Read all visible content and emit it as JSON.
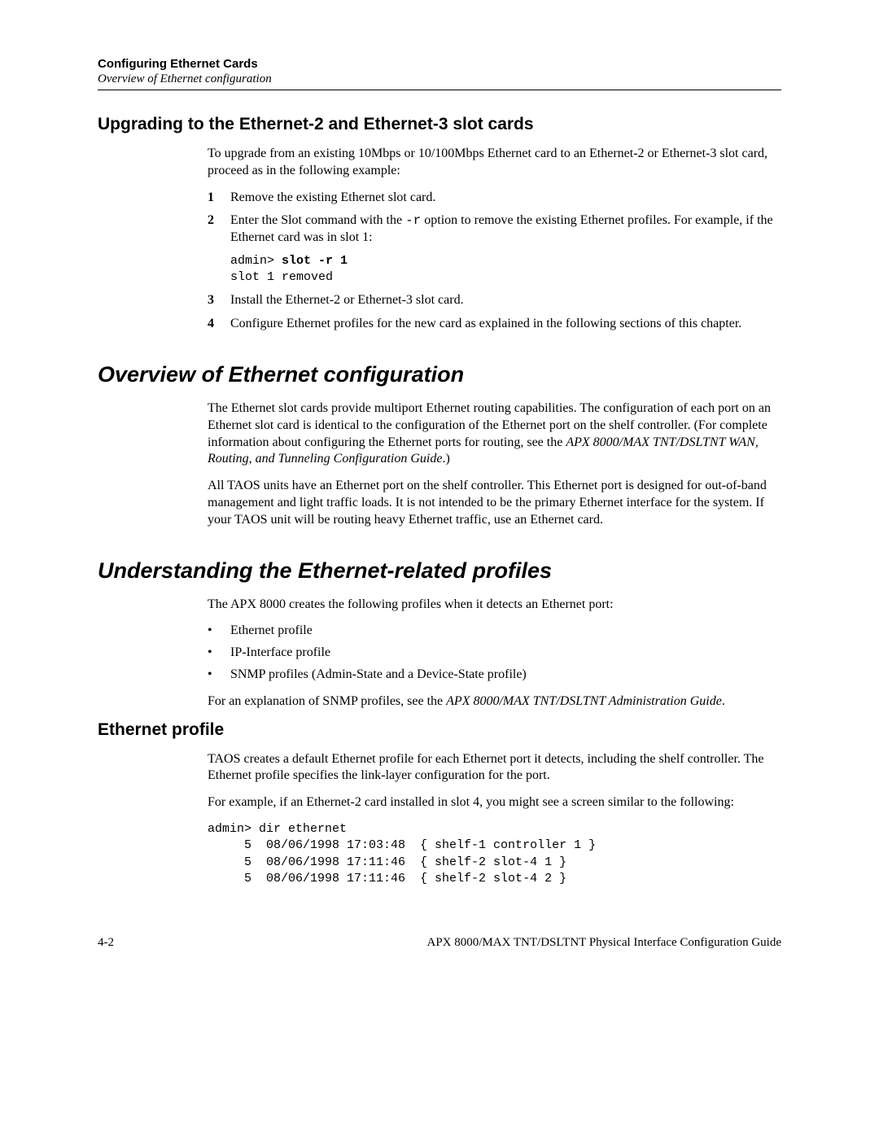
{
  "header": {
    "bold": "Configuring Ethernet Cards",
    "italic": "Overview of Ethernet configuration"
  },
  "section1": {
    "title": "Upgrading to the Ethernet-2 and Ethernet-3 slot cards",
    "intro": "To upgrade from an existing 10Mbps or 10/100Mbps Ethernet card to an Ethernet-2 or Ethernet-3 slot card, proceed as in the following example:",
    "step1_num": "1",
    "step1_txt": "Remove the existing Ethernet slot card.",
    "step2_num": "2",
    "step2_txt_a": "Enter the Slot command with the ",
    "step2_txt_opt": "-r",
    "step2_txt_b": " option to remove the existing Ethernet profiles. For example, if the Ethernet card was in slot 1:",
    "cmd_prompt": "admin> ",
    "cmd_bold": "slot -r 1",
    "cmd_output": "slot 1 removed",
    "step3_num": "3",
    "step3_txt": "Install the Ethernet-2 or Ethernet-3 slot card.",
    "step4_num": "4",
    "step4_txt": "Configure Ethernet profiles for the new card as explained in the following sections of this chapter."
  },
  "section2": {
    "title": "Overview of Ethernet configuration",
    "p1_a": "The Ethernet slot cards provide multiport Ethernet routing capabilities. The configuration of each port on an Ethernet slot card is identical to the configuration of the Ethernet port on the shelf controller. (For complete information about configuring the Ethernet ports for routing, see the ",
    "p1_ital": "APX 8000/MAX TNT/DSLTNT WAN, Routing, and Tunneling Configuration Guide",
    "p1_b": ".)",
    "p2": "All TAOS units have an Ethernet port on the shelf controller. This Ethernet port is designed for out-of-band management and light traffic loads. It is not intended to be the primary Ethernet interface for the system. If your TAOS unit will be routing heavy Ethernet traffic, use an Ethernet card."
  },
  "section3": {
    "title": "Understanding the Ethernet-related profiles",
    "intro": "The APX 8000 creates the following profiles when it detects an Ethernet port:",
    "bullet1": "Ethernet profile",
    "bullet2": "IP-Interface profile",
    "bullet3": "SNMP profiles (Admin-State and a Device-State profile)",
    "p2_a": "For an explanation of SNMP profiles, see the ",
    "p2_ital": "APX 8000/MAX TNT/DSLTNT Administration Guide",
    "p2_b": "."
  },
  "section4": {
    "title": "Ethernet profile",
    "p1": "TAOS creates a default Ethernet profile for each Ethernet port it detects, including the shelf controller. The Ethernet profile specifies the link-layer configuration for the port.",
    "p2": "For example, if an Ethernet-2 card installed in slot 4, you might see a screen similar to the following:",
    "cmd_prompt": "admin> ",
    "cmd_bold": "dir ethernet",
    "cmd_line1": "     5  08/06/1998 17:03:48  { shelf-1 controller 1 }",
    "cmd_line2": "     5  08/06/1998 17:11:46  { shelf-2 slot-4 1 }",
    "cmd_line3": "     5  08/06/1998 17:11:46  { shelf-2 slot-4 2 }"
  },
  "footer": {
    "left": "4-2",
    "right": "APX 8000/MAX TNT/DSLTNT Physical Interface Configuration Guide"
  },
  "bullet_glyph": "•"
}
